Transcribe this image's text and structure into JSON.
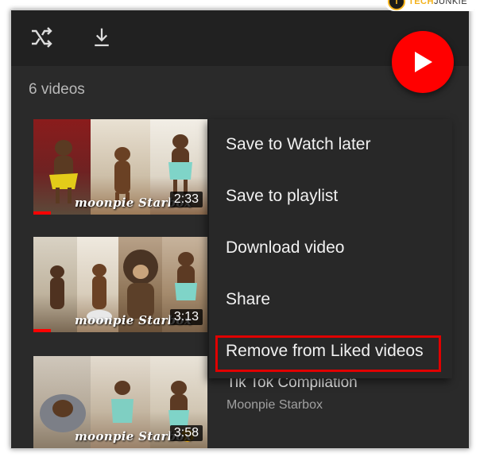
{
  "toolbar": {
    "shuffle_icon": "shuffle-icon",
    "download_icon": "download-icon",
    "play_icon": "play-icon"
  },
  "colors": {
    "accent": "#ff0000",
    "background": "#2a2a2a",
    "menu_bg": "#282828",
    "highlight": "#e00000"
  },
  "watermark": {
    "logo": "T",
    "prefix": "TECH",
    "suffix": "JUNKIE"
  },
  "list": {
    "count_label": "6 videos"
  },
  "videos": [
    {
      "duration": "2:33",
      "brand": "moonpie Starbox",
      "progress": 0.1
    },
    {
      "duration": "3:13",
      "brand": "moonpie Starbox",
      "progress": 0.1
    },
    {
      "duration": "3:58",
      "brand": "moonpie Starbox",
      "title": "Tik Tok Compilation",
      "channel": "Moonpie Starbox"
    }
  ],
  "menu": {
    "items": [
      {
        "label": "Save to Watch later"
      },
      {
        "label": "Save to playlist"
      },
      {
        "label": "Download video"
      },
      {
        "label": "Share"
      },
      {
        "label": "Remove from Liked videos"
      }
    ]
  }
}
